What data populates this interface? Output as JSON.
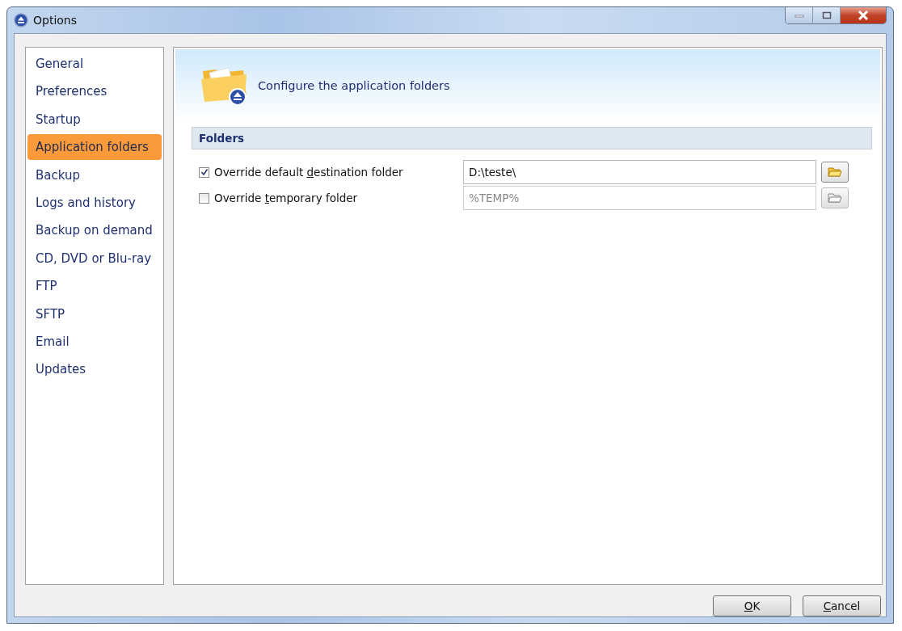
{
  "window": {
    "title": "Options"
  },
  "sidebar": {
    "items": [
      {
        "label": "General",
        "selected": false
      },
      {
        "label": "Preferences",
        "selected": false
      },
      {
        "label": "Startup",
        "selected": false
      },
      {
        "label": "Application folders",
        "selected": true
      },
      {
        "label": "Backup",
        "selected": false
      },
      {
        "label": "Logs and history",
        "selected": false
      },
      {
        "label": "Backup on demand",
        "selected": false
      },
      {
        "label": "CD, DVD or Blu-ray",
        "selected": false
      },
      {
        "label": "FTP",
        "selected": false
      },
      {
        "label": "SFTP",
        "selected": false
      },
      {
        "label": "Email",
        "selected": false
      },
      {
        "label": "Updates",
        "selected": false
      }
    ]
  },
  "header": {
    "title": "Configure the application folders"
  },
  "section": {
    "title": "Folders"
  },
  "rows": [
    {
      "label": {
        "before": "Override default ",
        "key": "d",
        "after": "estination folder"
      },
      "checked": true,
      "value": "D:\\teste\\",
      "disabled": false
    },
    {
      "label": {
        "before": "Override ",
        "key": "t",
        "after": "emporary folder"
      },
      "checked": false,
      "value": "%TEMP%",
      "disabled": true
    }
  ],
  "buttons": [
    {
      "key": "O",
      "after": "K"
    },
    {
      "key": "C",
      "after": "ancel"
    }
  ]
}
